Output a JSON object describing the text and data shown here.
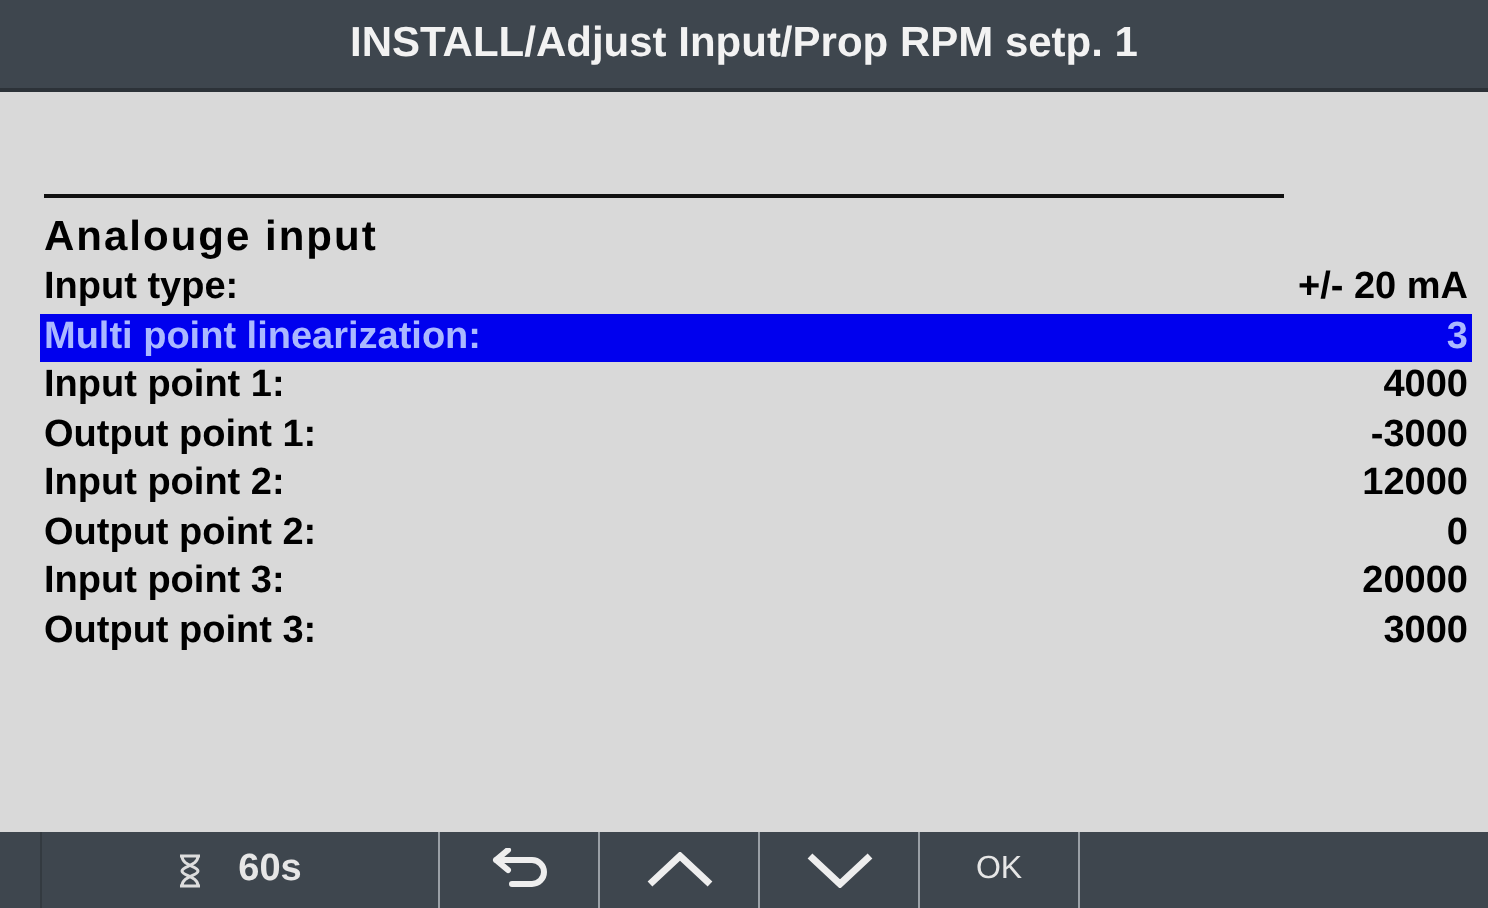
{
  "window": {
    "title": "INSTALL/Adjust Input/Prop RPM setp. 1"
  },
  "section": {
    "heading": "Analouge input"
  },
  "rows": [
    {
      "label": "Input type:",
      "value": "+/- 20 mA",
      "selected": false
    },
    {
      "label": "Multi point linearization:",
      "value": "3",
      "selected": true
    },
    {
      "label": "Input point 1:",
      "value": "4000",
      "selected": false
    },
    {
      "label": "Output point 1:",
      "value": "-3000",
      "selected": false
    },
    {
      "label": "Input point 2:",
      "value": "12000",
      "selected": false
    },
    {
      "label": "Output point 2:",
      "value": "0",
      "selected": false
    },
    {
      "label": "Input point 3:",
      "value": "20000",
      "selected": false
    },
    {
      "label": "Output point 3:",
      "value": "3000",
      "selected": false
    }
  ],
  "softkeys": [
    {
      "kind": "timer",
      "label": "60s"
    },
    {
      "kind": "back"
    },
    {
      "kind": "up"
    },
    {
      "kind": "down"
    },
    {
      "kind": "text",
      "label": "OK"
    },
    {
      "kind": "blank"
    }
  ]
}
